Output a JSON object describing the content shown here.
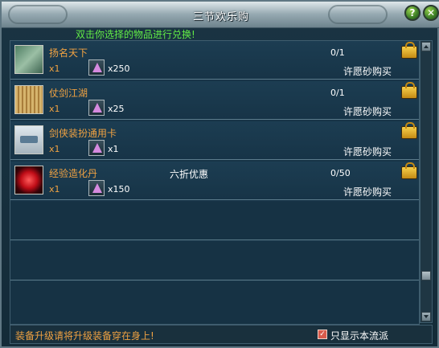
{
  "window": {
    "title": "三节欢乐购",
    "help_label": "?",
    "close_label": "✕"
  },
  "instruction": "双击你选择的物品进行兑换!",
  "items": [
    {
      "name": "扬名天下",
      "quantity": "x1",
      "cost": "x250",
      "discount": "",
      "stock": "0/1",
      "action": "许愿砂购买",
      "icon": "green-scroll-icon"
    },
    {
      "name": "仗剑江湖",
      "quantity": "x1",
      "cost": "x25",
      "discount": "",
      "stock": "0/1",
      "action": "许愿砂购买",
      "icon": "ancient-scroll-icon"
    },
    {
      "name": "剑侠装扮通用卡",
      "quantity": "x1",
      "cost": "x1",
      "discount": "",
      "stock": "",
      "action": "许愿砂购买",
      "icon": "outfit-card-icon"
    },
    {
      "name": "经验造化丹",
      "quantity": "x1",
      "cost": "x150",
      "discount": "六折优惠",
      "stock": "0/50",
      "action": "许愿砂购买",
      "icon": "experience-pill-icon"
    }
  ],
  "footer": {
    "note": "装备升级请将升级装备穿在身上!",
    "checkbox_label": "只显示本流派",
    "checkbox_checked": true
  },
  "colors": {
    "accent_orange": "#f0a242",
    "instruction_green": "#62ec46",
    "panel_bg": "#173447"
  }
}
